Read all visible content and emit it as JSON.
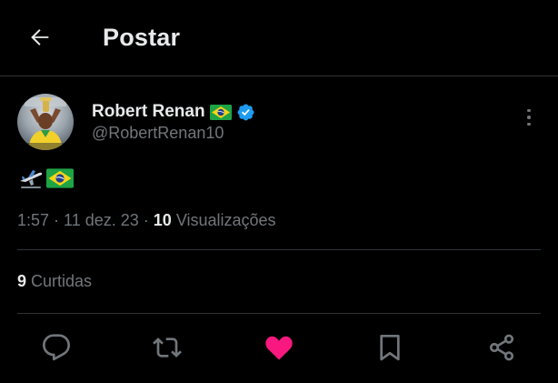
{
  "header": {
    "title": "Postar",
    "back_icon": "arrow-left-icon"
  },
  "author": {
    "display_name": "Robert Renan",
    "handle": "@RobertRenan10",
    "flag_icon": "brazil-flag-icon",
    "verified_icon": "verified-badge-icon",
    "verified_color": "#1d9bf0"
  },
  "tweet": {
    "emojis": [
      "airplane-departure-icon",
      "brazil-flag-icon"
    ]
  },
  "meta": {
    "time": "1:57",
    "sep1": " · ",
    "date": "11 dez. 23",
    "sep2": " · ",
    "views_count": "10",
    "views_label": " Visualizações"
  },
  "stats": {
    "likes_count": "9",
    "likes_label": " Curtidas"
  },
  "actions": [
    {
      "name": "reply",
      "icon": "comment-icon"
    },
    {
      "name": "repost",
      "icon": "repost-icon"
    },
    {
      "name": "like",
      "icon": "heart-icon",
      "active": true,
      "color": "#f91880"
    },
    {
      "name": "bookmark",
      "icon": "bookmark-icon"
    },
    {
      "name": "share",
      "icon": "share-icon"
    }
  ],
  "colors": {
    "background": "#000000",
    "text_primary": "#e7e9ea",
    "text_secondary": "#71767b",
    "divider": "#2f3336",
    "like_active": "#f91880"
  }
}
